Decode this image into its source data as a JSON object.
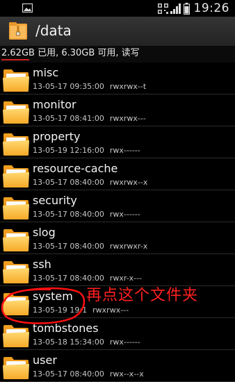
{
  "statusbar": {
    "time": "19:26",
    "icons": [
      "image-icon",
      "qr-grid-icon",
      "signal-icon",
      "battery-icon"
    ]
  },
  "titlebar": {
    "path": "/data",
    "icon": "folder-zip-icon"
  },
  "storage": {
    "used": "2.62GB",
    "summary": " 已用, 6.30GB 可用, 读写"
  },
  "files": [
    {
      "name": "misc",
      "date": "13-05-17 09:35:00",
      "perm": "rwxrwx--t"
    },
    {
      "name": "monitor",
      "date": "13-05-17 08:41:00",
      "perm": "rwxrwx---"
    },
    {
      "name": "property",
      "date": "13-05-19 12:16:00",
      "perm": "rwx------"
    },
    {
      "name": "resource-cache",
      "date": "13-05-17 08:40:00",
      "perm": "rwxrwx--x"
    },
    {
      "name": "security",
      "date": "13-05-17 08:40:00",
      "perm": "rwx------"
    },
    {
      "name": "slog",
      "date": "13-05-17 08:40:00",
      "perm": "rwxrwxr-x"
    },
    {
      "name": "ssh",
      "date": "13-05-17 08:40:00",
      "perm": "rwxr-x---"
    },
    {
      "name": "system",
      "date": "13-05-19 19:1",
      "perm": "rwxrwx---"
    },
    {
      "name": "tombstones",
      "date": "13-05-18 15:34:00",
      "perm": "rwx------"
    },
    {
      "name": "user",
      "date": "13-05-17 08:40:00",
      "perm": "rwx--x--x"
    }
  ],
  "annotation": {
    "text": "再点这个文件夹",
    "color": "#ff2020"
  },
  "colors": {
    "folder_body": "#f5a623",
    "folder_front": "#ffc94a",
    "annotation": "#ff2020"
  }
}
